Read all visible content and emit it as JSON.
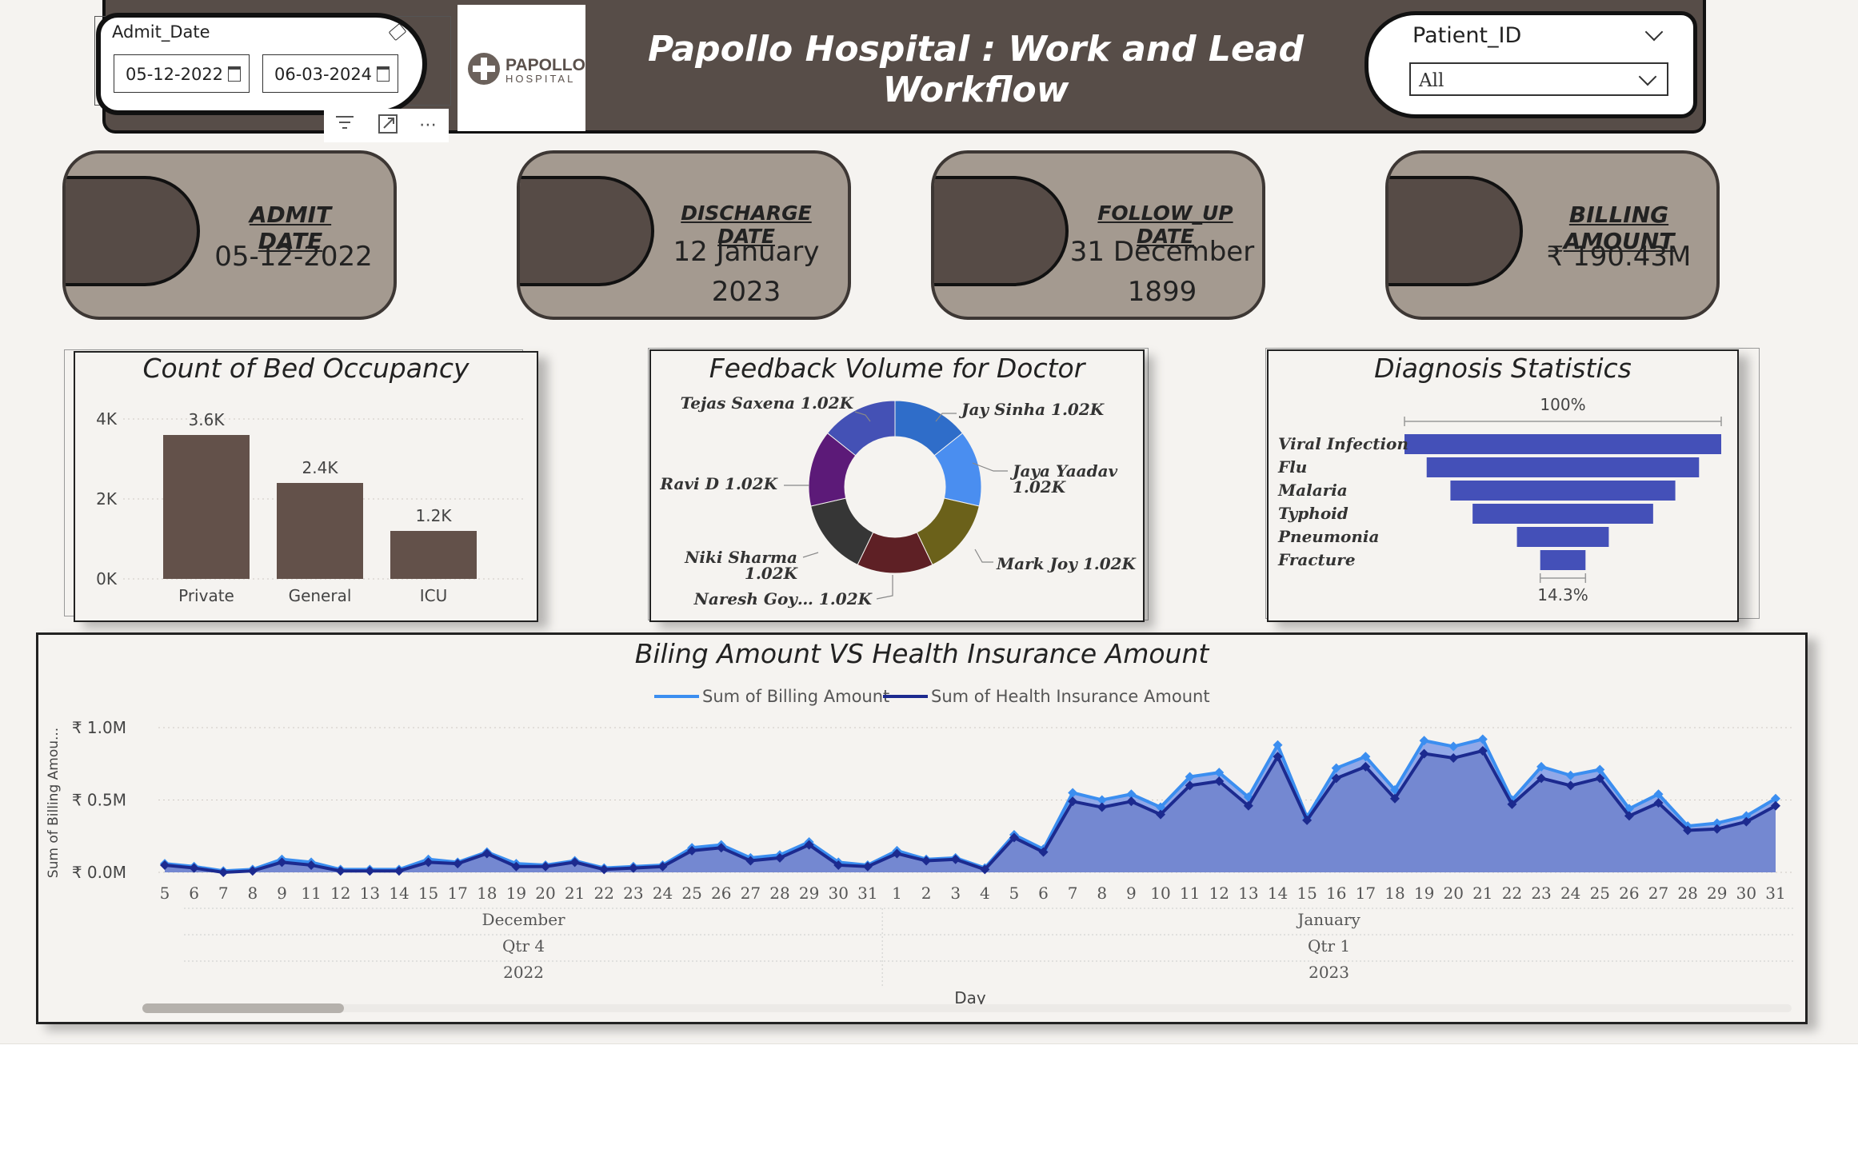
{
  "header": {
    "title": "Papollo Hospital : Work and Lead Workflow",
    "bar_color": "#574d48",
    "logo": {
      "name": "PAPOLLO",
      "sub": "HOSPITAL"
    }
  },
  "date_slicer": {
    "label": "Admit_Date",
    "start": "05-12-2022",
    "end": "06-03-2024",
    "icons": [
      "eraser-icon",
      "calendar-icon",
      "calendar-icon"
    ],
    "toolbar_icons": [
      "filter-icon",
      "focus-mode-icon",
      "more-options-icon"
    ],
    "more_glyph": "⋯"
  },
  "patient_slicer": {
    "label": "Patient_ID",
    "selected": "All"
  },
  "kpis": [
    {
      "label": "ADMIT DATE",
      "value_lines": [
        "05-12-2022"
      ]
    },
    {
      "label": "DISCHARGE DATE",
      "value_lines": [
        "12 January",
        "2023"
      ]
    },
    {
      "label": "FOLLOW_UP DATE",
      "value_lines": [
        "31 December",
        "1899"
      ]
    },
    {
      "label": "BILLING AMOUNT",
      "value_lines": [
        "₹ 190.43M"
      ]
    }
  ],
  "bed_chart": {
    "title": "Count of Bed Occupancy",
    "y_ticks": [
      "0K",
      "2K",
      "4K"
    ],
    "color": "#63514a"
  },
  "feedback_chart": {
    "title": "Feedback Volume for Doctor",
    "labels": [
      {
        "text": "Jay Sinha 1.02K"
      },
      {
        "text": "Jaya Yaadav"
      },
      {
        "text": "1.02K"
      },
      {
        "text": "Mark Joy 1.02K"
      },
      {
        "text": "Naresh Goy… 1.02K"
      },
      {
        "text": "Niki Sharma"
      },
      {
        "text": "1.02K"
      },
      {
        "text": "Ravi D 1.02K"
      },
      {
        "text": "Tejas Saxena 1.02K"
      }
    ]
  },
  "diagnosis_chart": {
    "title": "Diagnosis Statistics",
    "top_pct": "100%",
    "bottom_pct": "14.3%",
    "color": "#4450b8"
  },
  "line_chart": {
    "title": "Biling Amount VS Health Insurance Amount",
    "y_axis_title": "Sum of Billing Amou...",
    "x_axis_title": "Day",
    "y_ticks": [
      "₹ 0.0M",
      "₹ 0.5M",
      "₹ 1.0M"
    ],
    "month_labels": [
      "December",
      "January"
    ],
    "quarter_labels": [
      "Qtr 4",
      "Qtr 1"
    ],
    "year_labels": [
      "2022",
      "2023"
    ]
  },
  "chart_data": [
    {
      "type": "bar",
      "title": "Count of Bed Occupancy",
      "categories": [
        "Private",
        "General",
        "ICU"
      ],
      "values": [
        3600,
        2400,
        1200
      ],
      "value_labels": [
        "3.6K",
        "2.4K",
        "1.2K"
      ],
      "ylim": [
        0,
        4000
      ],
      "grid": true
    },
    {
      "type": "pie",
      "title": "Feedback Volume for Doctor",
      "donut": true,
      "categories": [
        "Jay Sinha",
        "Jaya Yaadav",
        "Mark Joy",
        "Naresh Goy…",
        "Niki Sharma",
        "Ravi D",
        "Tejas Saxena"
      ],
      "values": [
        1020,
        1020,
        1020,
        1020,
        1020,
        1020,
        1020
      ],
      "colors": [
        "#2f6dc9",
        "#4a8ef0",
        "#6b611a",
        "#5e2025",
        "#363636",
        "#5c1a78",
        "#4451b5"
      ]
    },
    {
      "type": "bar",
      "subtype": "funnel",
      "title": "Diagnosis Statistics",
      "categories": [
        "Viral Infection",
        "Flu",
        "Malaria",
        "Typhoid",
        "Pneumonia",
        "Fracture"
      ],
      "values": [
        100,
        86,
        71,
        57,
        29,
        14.3
      ],
      "unit": "% of first stage"
    },
    {
      "type": "area",
      "title": "Biling Amount VS Health Insurance Amount",
      "x": [
        "5",
        "6",
        "7",
        "8",
        "9",
        "11",
        "12",
        "13",
        "14",
        "15",
        "17",
        "18",
        "19",
        "20",
        "21",
        "22",
        "23",
        "24",
        "25",
        "26",
        "27",
        "28",
        "29",
        "30",
        "31",
        "1",
        "2",
        "3",
        "4",
        "5",
        "6",
        "7",
        "8",
        "9",
        "10",
        "11",
        "12",
        "13",
        "14",
        "15",
        "16",
        "17",
        "18",
        "19",
        "20",
        "21",
        "22",
        "23",
        "24",
        "25",
        "26",
        "27",
        "28",
        "29",
        "30",
        "31"
      ],
      "series": [
        {
          "name": "Sum of Billing Amount",
          "color": "#3b8ef0",
          "values": [
            0.06,
            0.04,
            0.01,
            0.02,
            0.09,
            0.07,
            0.02,
            0.02,
            0.02,
            0.09,
            0.07,
            0.14,
            0.06,
            0.05,
            0.08,
            0.03,
            0.04,
            0.05,
            0.17,
            0.19,
            0.1,
            0.12,
            0.21,
            0.07,
            0.05,
            0.15,
            0.09,
            0.1,
            0.03,
            0.26,
            0.16,
            0.55,
            0.5,
            0.54,
            0.45,
            0.66,
            0.69,
            0.52,
            0.88,
            0.38,
            0.72,
            0.8,
            0.57,
            0.91,
            0.87,
            0.92,
            0.5,
            0.73,
            0.67,
            0.71,
            0.44,
            0.54,
            0.32,
            0.34,
            0.39,
            0.51
          ]
        },
        {
          "name": "Sum of Health Insurance Amount",
          "color": "#1c2a8f",
          "values": [
            0.05,
            0.03,
            0.0,
            0.01,
            0.07,
            0.05,
            0.01,
            0.01,
            0.01,
            0.07,
            0.06,
            0.13,
            0.04,
            0.04,
            0.07,
            0.02,
            0.03,
            0.04,
            0.15,
            0.17,
            0.08,
            0.1,
            0.19,
            0.05,
            0.04,
            0.13,
            0.08,
            0.09,
            0.02,
            0.24,
            0.14,
            0.49,
            0.45,
            0.49,
            0.4,
            0.6,
            0.63,
            0.46,
            0.8,
            0.36,
            0.65,
            0.73,
            0.51,
            0.82,
            0.79,
            0.84,
            0.47,
            0.65,
            0.6,
            0.65,
            0.39,
            0.48,
            0.29,
            0.3,
            0.35,
            0.46
          ]
        }
      ],
      "ylim": [
        0,
        1.0
      ],
      "y_unit": "₹ M",
      "legend": "top-center",
      "grid": true
    }
  ]
}
